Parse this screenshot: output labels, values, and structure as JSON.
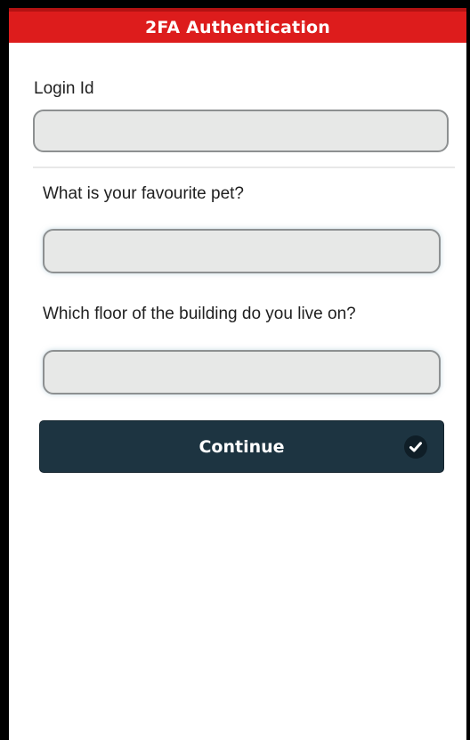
{
  "header": {
    "title": "2FA Authentication",
    "color": "#dd1c1c"
  },
  "form": {
    "login_label": "Login Id",
    "login_value": "",
    "questions": [
      {
        "label": "What is your favourite pet?",
        "value": ""
      },
      {
        "label": "Which floor of the building do you live on?",
        "value": ""
      }
    ]
  },
  "actions": {
    "continue_label": "Continue",
    "continue_icon": "check-icon",
    "button_color": "#1d3441"
  }
}
